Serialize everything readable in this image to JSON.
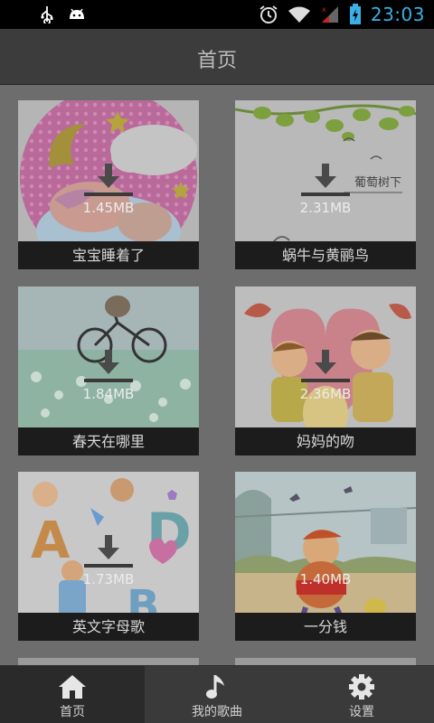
{
  "status_bar": {
    "time": "23:03",
    "icons": [
      "usb-icon",
      "android-debug-icon",
      "alarm-icon",
      "wifi-icon",
      "signal-icon",
      "battery-charging-icon"
    ]
  },
  "header": {
    "title": "首页"
  },
  "songs": [
    {
      "title": "宝宝睡着了",
      "size": "1.45MB",
      "download_icon": true
    },
    {
      "title": "蜗牛与黄鹂鸟",
      "size": "2.31MB",
      "download_icon": true,
      "art_text": "葡萄树下"
    },
    {
      "title": "春天在哪里",
      "size": "1.84MB",
      "download_icon": true
    },
    {
      "title": "妈妈的吻",
      "size": "2.36MB",
      "download_icon": true
    },
    {
      "title": "英文字母歌",
      "size": "1.73MB",
      "download_icon": true
    },
    {
      "title": "一分钱",
      "size": "1.40MB",
      "download_icon": false
    }
  ],
  "tabs": [
    {
      "label": "首页",
      "icon": "home-icon",
      "active": true
    },
    {
      "label": "我的歌曲",
      "icon": "music-note-icon",
      "active": false
    },
    {
      "label": "设置",
      "icon": "gear-icon",
      "active": false
    }
  ],
  "colors": {
    "clock": "#3ab0e6",
    "title_bar": "#3c3c3c",
    "caption_bg": "#1c1c1c",
    "tab_bar": "#3a3a3a"
  }
}
